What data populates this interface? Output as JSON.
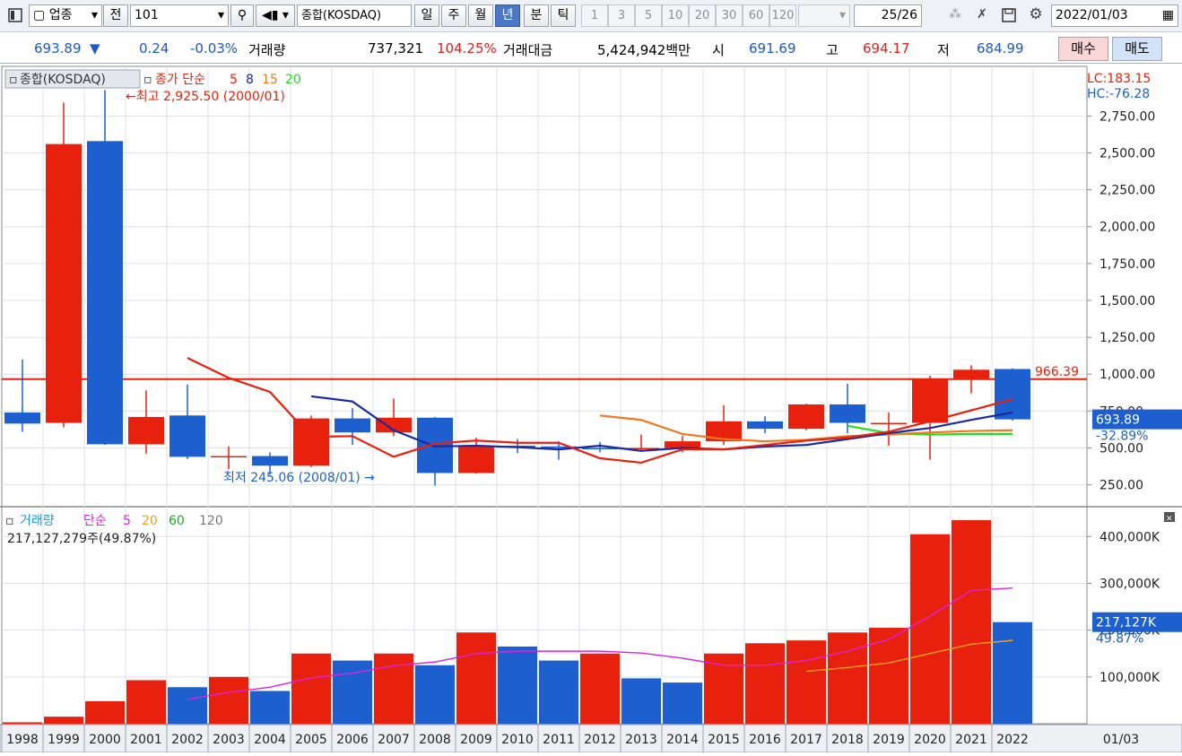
{
  "toolbar": {
    "sector_label": "업종",
    "prev_label": "전",
    "code_value": "101",
    "index_name": "종합(KOSDAQ)",
    "periods": [
      "일",
      "주",
      "월",
      "년",
      "분",
      "틱"
    ],
    "active_period": "년",
    "intervals": [
      "1",
      "3",
      "5",
      "10",
      "20",
      "30",
      "60",
      "120"
    ],
    "page_counter": "25",
    "page_total": "/26",
    "date_value": "2022/01/03"
  },
  "quote": {
    "price": "693.89",
    "arrow": "▼",
    "change": "0.24",
    "change_pct": "-0.03%",
    "volume_label": "거래량",
    "volume": "737,321",
    "volume_pct": "104.25%",
    "amount_label": "거래대금",
    "amount": "5,424,942백만",
    "open_label": "시",
    "open": "691.69",
    "high_label": "고",
    "high": "694.17",
    "low_label": "저",
    "low": "684.99",
    "buy_label": "매수",
    "sell_label": "매도"
  },
  "colors": {
    "up": "#e8210f",
    "down": "#1e5fcf",
    "ma5": "#e8210f",
    "ma8": "#1a2aa0",
    "ma15": "#f07820",
    "ma20": "#22dd22",
    "vma5": "#dd22dd",
    "vma20": "#f0a020",
    "vma60": "#22aa22"
  },
  "chart_data": [
    {
      "type": "candlestick",
      "title": "종합(KOSDAQ)",
      "legend": {
        "ma_label": "종가 단순",
        "periods": [
          "5",
          "8",
          "15",
          "20"
        ]
      },
      "lc_label": "LC:183.15",
      "hc_label": "HC:-76.28",
      "categories": [
        "1998",
        "1999",
        "2000",
        "2001",
        "2002",
        "2003",
        "2004",
        "2005",
        "2006",
        "2007",
        "2008",
        "2009",
        "2010",
        "2011",
        "2012",
        "2013",
        "2014",
        "2015",
        "2016",
        "2017",
        "2018",
        "2019",
        "2020",
        "2021",
        "2022"
      ],
      "ohlc": [
        {
          "o": 740,
          "h": 1100,
          "l": 610,
          "c": 665
        },
        {
          "o": 670,
          "h": 2840,
          "l": 640,
          "c": 2560
        },
        {
          "o": 2580,
          "h": 2925.5,
          "l": 520,
          "c": 525
        },
        {
          "o": 525,
          "h": 890,
          "l": 460,
          "c": 710
        },
        {
          "o": 720,
          "h": 930,
          "l": 425,
          "c": 440
        },
        {
          "o": 440,
          "h": 510,
          "l": 355,
          "c": 445
        },
        {
          "o": 445,
          "h": 470,
          "l": 320,
          "c": 380
        },
        {
          "o": 380,
          "h": 720,
          "l": 370,
          "c": 700
        },
        {
          "o": 700,
          "h": 770,
          "l": 520,
          "c": 605
        },
        {
          "o": 605,
          "h": 835,
          "l": 580,
          "c": 705
        },
        {
          "o": 705,
          "h": 710,
          "l": 245.06,
          "c": 330
        },
        {
          "o": 330,
          "h": 570,
          "l": 325,
          "c": 515
        },
        {
          "o": 515,
          "h": 560,
          "l": 465,
          "c": 510
        },
        {
          "o": 510,
          "h": 545,
          "l": 420,
          "c": 500
        },
        {
          "o": 500,
          "h": 540,
          "l": 470,
          "c": 495
        },
        {
          "o": 495,
          "h": 590,
          "l": 480,
          "c": 500
        },
        {
          "o": 500,
          "h": 580,
          "l": 470,
          "c": 545
        },
        {
          "o": 545,
          "h": 790,
          "l": 520,
          "c": 680
        },
        {
          "o": 680,
          "h": 715,
          "l": 600,
          "c": 630
        },
        {
          "o": 630,
          "h": 800,
          "l": 620,
          "c": 795
        },
        {
          "o": 795,
          "h": 935,
          "l": 600,
          "c": 670
        },
        {
          "o": 670,
          "h": 740,
          "l": 515,
          "c": 670
        },
        {
          "o": 670,
          "h": 990,
          "l": 420,
          "c": 970
        },
        {
          "o": 965,
          "h": 1060,
          "l": 870,
          "c": 1030
        },
        {
          "o": 1035,
          "h": 1040,
          "l": 685,
          "c": 693.89
        }
      ],
      "ma5": [
        null,
        null,
        null,
        null,
        1110,
        975,
        880,
        575,
        580,
        440,
        530,
        550,
        535,
        535,
        430,
        400,
        490,
        490,
        520,
        550,
        570,
        610,
        680,
        755,
        830
      ],
      "ma8": [
        null,
        null,
        null,
        null,
        null,
        null,
        null,
        850,
        815,
        620,
        510,
        515,
        505,
        490,
        515,
        480,
        500,
        490,
        510,
        520,
        560,
        600,
        635,
        690,
        740
      ],
      "ma15": [
        null,
        null,
        null,
        null,
        null,
        null,
        null,
        null,
        null,
        null,
        null,
        null,
        null,
        null,
        720,
        690,
        595,
        560,
        545,
        555,
        580,
        590,
        605,
        615,
        620
      ],
      "ma20": [
        null,
        null,
        null,
        null,
        null,
        null,
        null,
        null,
        null,
        null,
        null,
        null,
        null,
        null,
        null,
        null,
        null,
        null,
        null,
        null,
        650,
        600,
        590,
        595,
        595
      ],
      "max_label": "최고 2,925.50 (2000/01)",
      "min_label": "최저 245.06 (2008/01)",
      "hline": {
        "value": 966.39,
        "label": "966.39"
      },
      "current": {
        "value": 693.89,
        "label": "693.89",
        "pct_label": "-32.89%"
      },
      "y_ticks": [
        "250.00",
        "500.00",
        "750.00",
        "1,000.00",
        "1,250.00",
        "1,500.00",
        "1,750.00",
        "2,000.00",
        "2,250.00",
        "2,500.00",
        "2,750.00"
      ],
      "y_tick_values": [
        250,
        500,
        750,
        1000,
        1250,
        1500,
        1750,
        2000,
        2250,
        2500,
        2750
      ],
      "ylim": [
        120,
        3050
      ]
    },
    {
      "type": "bar",
      "title": "거래량",
      "legend": {
        "ma_label": "단순",
        "periods": [
          "5",
          "20",
          "60",
          "120"
        ]
      },
      "volume_readout": "217,127,279주(49.87%)",
      "values": [
        3000,
        15000,
        48000,
        93000,
        78000,
        100000,
        70000,
        150000,
        135000,
        150000,
        125000,
        195000,
        165000,
        135000,
        150000,
        97000,
        88000,
        150000,
        172000,
        178000,
        195000,
        205000,
        405000,
        435000,
        217127
      ],
      "directions": [
        "up",
        "up",
        "up",
        "up",
        "down",
        "up",
        "down",
        "up",
        "down",
        "up",
        "down",
        "up",
        "down",
        "down",
        "up",
        "down",
        "down",
        "up",
        "up",
        "up",
        "up",
        "up",
        "up",
        "up",
        "down"
      ],
      "vma5": [
        null,
        null,
        null,
        null,
        52000,
        67000,
        78000,
        98000,
        108000,
        124000,
        132000,
        150000,
        155000,
        155000,
        155000,
        151000,
        140000,
        125000,
        125000,
        135000,
        155000,
        180000,
        230000,
        285000,
        290000
      ],
      "vma20": [
        null,
        null,
        null,
        null,
        null,
        null,
        null,
        null,
        null,
        null,
        null,
        null,
        null,
        null,
        null,
        null,
        null,
        null,
        null,
        112000,
        120000,
        130000,
        150000,
        170000,
        178000
      ],
      "y_ticks": [
        "100,000K",
        "200,000K",
        "300,000K",
        "400,000K"
      ],
      "y_tick_values": [
        100000,
        200000,
        300000,
        400000
      ],
      "current": {
        "value": 217127,
        "label": "217,127K",
        "pct_label": "49.87%"
      },
      "ylim": [
        0,
        460000
      ]
    }
  ],
  "x_end_label": "01/03"
}
